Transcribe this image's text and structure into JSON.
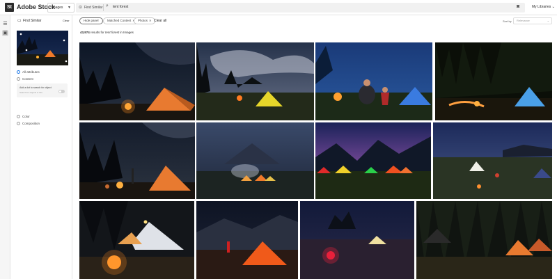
{
  "app": {
    "logo_mark": "St",
    "name": "Adobe Stock"
  },
  "header": {
    "asset_type": "Images",
    "find_similar_label": "Find Similar",
    "search_query": "tent forest",
    "libraries_label": "My Libraries"
  },
  "panel": {
    "title": "Find Similar",
    "clear_label": "Clear",
    "attributes": [
      {
        "label": "All attributes",
        "selected": true
      },
      {
        "label": "Content",
        "selected": false
      },
      {
        "label": "Color",
        "selected": false
      },
      {
        "label": "Composition",
        "selected": false
      }
    ],
    "hint_title": "Add a dot to search for object",
    "hint_sub": "Search for objects in this"
  },
  "filters": {
    "hide_panel_label": "Hide panel",
    "chips": [
      {
        "label": "Matched Content"
      },
      {
        "label": "Photos"
      }
    ],
    "clear_all_label": "Clear all"
  },
  "sort": {
    "label": "Sort by",
    "value": "Relevance"
  },
  "results": {
    "count": "43,974",
    "text_before": "results for",
    "query": "tent forest",
    "text_after": "in Images"
  },
  "icons": {
    "rail_top": "filter-icon",
    "rail_second": "image-stack-icon",
    "camera": "camera-search-icon",
    "search": "search-icon"
  },
  "colors": {
    "accent": "#1473e6",
    "tent_orange": "#f07a2a",
    "tent_yellow": "#e6d62a",
    "tent_blue": "#3a7be0"
  }
}
